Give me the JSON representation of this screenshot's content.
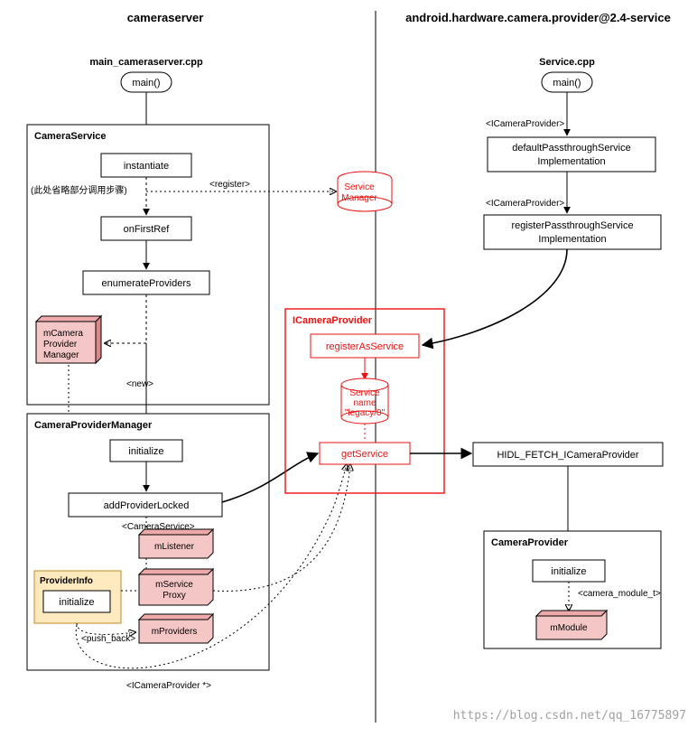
{
  "left": {
    "title": "cameraserver",
    "file": "main_cameraserver.cpp",
    "main": "main()",
    "cs": {
      "name": "CameraService",
      "instantiate": "instantiate",
      "note": "(此处省略部分调用步骤)",
      "register": "<register>",
      "onFirstRef": "onFirstRef",
      "enumerate": "enumerateProviders",
      "mgrBox": "mCamera\nProvider\nManager",
      "newLbl": "<new>"
    },
    "cpm": {
      "name": "CameraProviderManager",
      "initialize": "initialize",
      "addProviderLocked": "addProviderLocked",
      "csLbl": "<CameraService>",
      "mListener": "mListener",
      "mServiceProxy": "mService\nProxy",
      "mProviders": "mProviders",
      "pi": {
        "name": "ProviderInfo",
        "initialize": "initialize"
      },
      "pushBack": "<push_back>",
      "icp": "<ICameraProvider *>"
    }
  },
  "right": {
    "title": "android.hardware.camera.provider@2.4-service",
    "file": "Service.cpp",
    "main": "main()",
    "icpLbl1": "<ICameraProvider>",
    "defaultPass": "defaultPassthroughService\nImplementation",
    "icpLbl2": "<ICameraProvider>",
    "registerPass": "registerPassthroughService\nImplementation",
    "fetch": "HIDL_FETCH_ICameraProvider",
    "cp": {
      "name": "CameraProvider",
      "initialize": "initialize",
      "cmt": "<camera_module_t>",
      "mModule": "mModule"
    }
  },
  "mid": {
    "svcMgr": "Service\nManager",
    "icp": "ICameraProvider",
    "registerAsService": "registerAsService",
    "svcName": "Service\nname\n\"legacy/0\"",
    "getService": "getService"
  },
  "watermark": "https://blog.csdn.net/qq_16775897"
}
